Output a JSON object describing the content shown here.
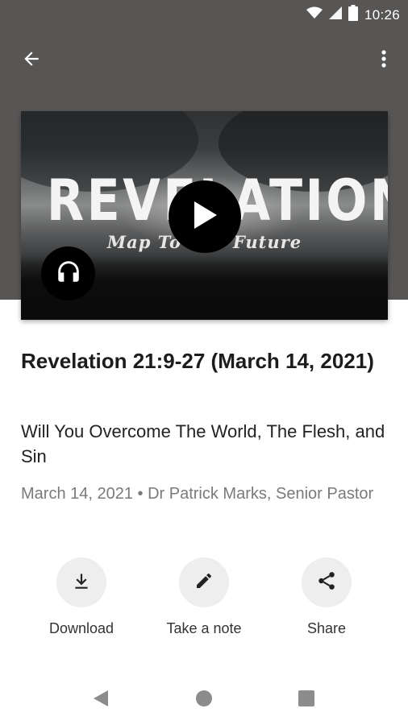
{
  "status_bar": {
    "time": "10:26"
  },
  "media": {
    "artwork_title": "REVELATION",
    "artwork_subtitle": "Map To The Future"
  },
  "sermon": {
    "title": "Revelation 21:9-27 (March 14, 2021)",
    "subtitle": "Will You Overcome The World, The Flesh, and Sin",
    "meta": "March 14, 2021 • Dr Patrick Marks, Senior Pastor"
  },
  "actions": [
    {
      "label": "Download",
      "icon": "download-icon"
    },
    {
      "label": "Take a note",
      "icon": "pencil-icon"
    },
    {
      "label": "Share",
      "icon": "share-icon"
    }
  ],
  "colors": {
    "header_background": "#585655",
    "action_circle": "#eeeeee",
    "meta_text": "#7a7a7a"
  }
}
